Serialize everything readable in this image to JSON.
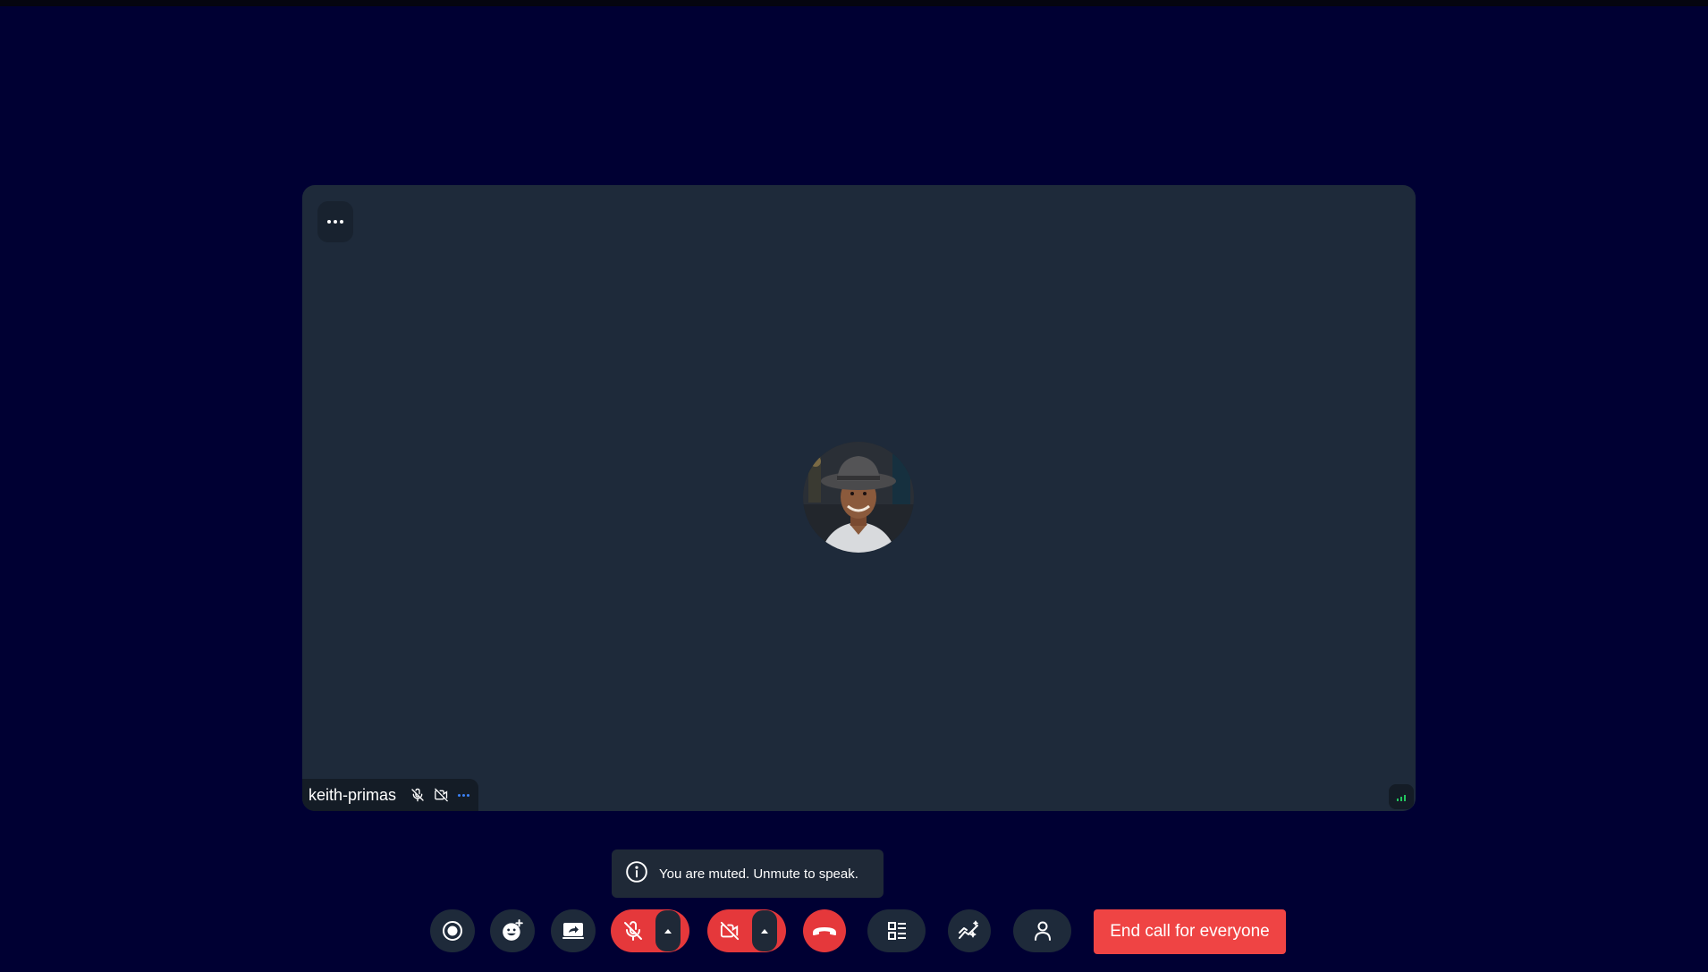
{
  "participant": {
    "name": "keith-primas",
    "mic_status": "muted",
    "camera_status": "off"
  },
  "toast": {
    "message": "You are muted. Unmute to speak."
  },
  "controls": {
    "end_call_for_everyone_label": "End call for everyone"
  },
  "colors": {
    "background": "#000033",
    "tile": "#1e2a3a",
    "danger": "#e5383b",
    "end_all": "#ef4444",
    "signal": "#22c55e",
    "accent": "#3b82f6"
  },
  "icons": [
    "more-horizontal-icon",
    "mic-off-icon",
    "video-off-icon",
    "signal-bars-icon",
    "info-icon",
    "record-icon",
    "emoji-icon",
    "screen-share-icon",
    "caret-up-icon",
    "hang-up-icon",
    "layout-icon",
    "sparkles-icon",
    "person-icon"
  ]
}
